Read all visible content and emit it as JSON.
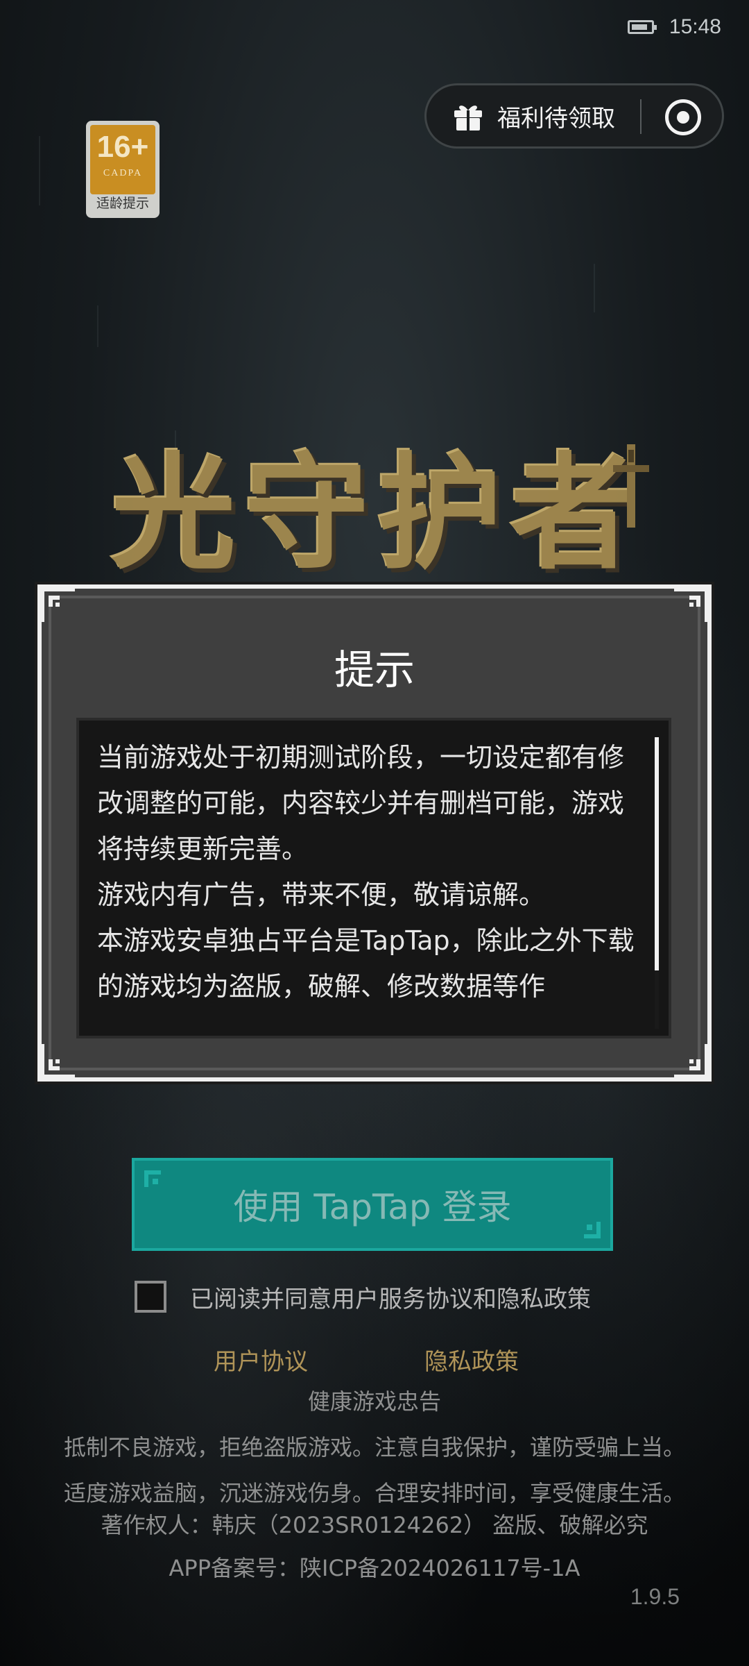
{
  "status_bar": {
    "time": "15:48",
    "battery_icon": "battery-icon"
  },
  "top_capsule": {
    "gift_label": "福利待领取",
    "gift_icon": "gift-icon",
    "target_icon": "target-icon"
  },
  "age_badge": {
    "rating": "16+",
    "org": "CADPA",
    "caption": "适龄提示"
  },
  "logo": {
    "title": "光守护者"
  },
  "dialog": {
    "title": "提示",
    "body": "当前游戏处于初期测试阶段，一切设定都有修改调整的可能，内容较少并有删档可能，游戏将持续更新完善。\n游戏内有广告，带来不便，敬请谅解。\n本游戏安卓独占平台是TapTap，除此之外下载的游戏均为盗版，破解、修改数据等作"
  },
  "login": {
    "button_label": "使用 TapTap 登录"
  },
  "agreement": {
    "checked": false,
    "text": "已阅读并同意用户服务协议和隐私政策"
  },
  "links": {
    "user_agreement": "用户协议",
    "privacy_policy": "隐私政策"
  },
  "health": {
    "title": "健康游戏忠告",
    "line1": "抵制不良游戏，拒绝盗版游戏。注意自我保护，谨防受骗上当。",
    "line2": "适度游戏益脑，沉迷游戏伤身。合理安排时间，享受健康生活。"
  },
  "copyright": "著作权人：韩庆（2023SR0124262） 盗版、破解必究",
  "icp": "APP备案号：陕ICP备2024026117号-1A",
  "version": "1.9.5",
  "colors": {
    "login_bg": "#0f8880",
    "link": "#b09458",
    "dialog_bg": "#3f3f3f"
  }
}
